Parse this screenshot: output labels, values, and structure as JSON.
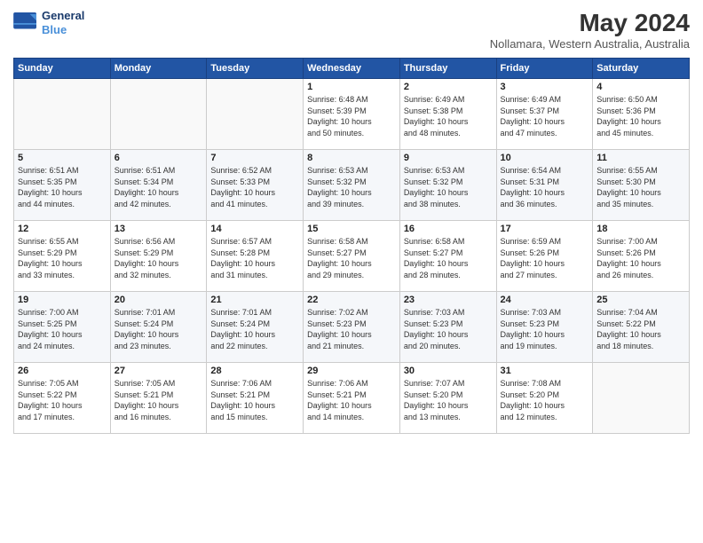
{
  "logo": {
    "line1": "General",
    "line2": "Blue"
  },
  "title": "May 2024",
  "subtitle": "Nollamara, Western Australia, Australia",
  "headers": [
    "Sunday",
    "Monday",
    "Tuesday",
    "Wednesday",
    "Thursday",
    "Friday",
    "Saturday"
  ],
  "rows": [
    [
      {
        "day": "",
        "info": ""
      },
      {
        "day": "",
        "info": ""
      },
      {
        "day": "",
        "info": ""
      },
      {
        "day": "1",
        "info": "Sunrise: 6:48 AM\nSunset: 5:39 PM\nDaylight: 10 hours\nand 50 minutes."
      },
      {
        "day": "2",
        "info": "Sunrise: 6:49 AM\nSunset: 5:38 PM\nDaylight: 10 hours\nand 48 minutes."
      },
      {
        "day": "3",
        "info": "Sunrise: 6:49 AM\nSunset: 5:37 PM\nDaylight: 10 hours\nand 47 minutes."
      },
      {
        "day": "4",
        "info": "Sunrise: 6:50 AM\nSunset: 5:36 PM\nDaylight: 10 hours\nand 45 minutes."
      }
    ],
    [
      {
        "day": "5",
        "info": "Sunrise: 6:51 AM\nSunset: 5:35 PM\nDaylight: 10 hours\nand 44 minutes."
      },
      {
        "day": "6",
        "info": "Sunrise: 6:51 AM\nSunset: 5:34 PM\nDaylight: 10 hours\nand 42 minutes."
      },
      {
        "day": "7",
        "info": "Sunrise: 6:52 AM\nSunset: 5:33 PM\nDaylight: 10 hours\nand 41 minutes."
      },
      {
        "day": "8",
        "info": "Sunrise: 6:53 AM\nSunset: 5:32 PM\nDaylight: 10 hours\nand 39 minutes."
      },
      {
        "day": "9",
        "info": "Sunrise: 6:53 AM\nSunset: 5:32 PM\nDaylight: 10 hours\nand 38 minutes."
      },
      {
        "day": "10",
        "info": "Sunrise: 6:54 AM\nSunset: 5:31 PM\nDaylight: 10 hours\nand 36 minutes."
      },
      {
        "day": "11",
        "info": "Sunrise: 6:55 AM\nSunset: 5:30 PM\nDaylight: 10 hours\nand 35 minutes."
      }
    ],
    [
      {
        "day": "12",
        "info": "Sunrise: 6:55 AM\nSunset: 5:29 PM\nDaylight: 10 hours\nand 33 minutes."
      },
      {
        "day": "13",
        "info": "Sunrise: 6:56 AM\nSunset: 5:29 PM\nDaylight: 10 hours\nand 32 minutes."
      },
      {
        "day": "14",
        "info": "Sunrise: 6:57 AM\nSunset: 5:28 PM\nDaylight: 10 hours\nand 31 minutes."
      },
      {
        "day": "15",
        "info": "Sunrise: 6:58 AM\nSunset: 5:27 PM\nDaylight: 10 hours\nand 29 minutes."
      },
      {
        "day": "16",
        "info": "Sunrise: 6:58 AM\nSunset: 5:27 PM\nDaylight: 10 hours\nand 28 minutes."
      },
      {
        "day": "17",
        "info": "Sunrise: 6:59 AM\nSunset: 5:26 PM\nDaylight: 10 hours\nand 27 minutes."
      },
      {
        "day": "18",
        "info": "Sunrise: 7:00 AM\nSunset: 5:26 PM\nDaylight: 10 hours\nand 26 minutes."
      }
    ],
    [
      {
        "day": "19",
        "info": "Sunrise: 7:00 AM\nSunset: 5:25 PM\nDaylight: 10 hours\nand 24 minutes."
      },
      {
        "day": "20",
        "info": "Sunrise: 7:01 AM\nSunset: 5:24 PM\nDaylight: 10 hours\nand 23 minutes."
      },
      {
        "day": "21",
        "info": "Sunrise: 7:01 AM\nSunset: 5:24 PM\nDaylight: 10 hours\nand 22 minutes."
      },
      {
        "day": "22",
        "info": "Sunrise: 7:02 AM\nSunset: 5:23 PM\nDaylight: 10 hours\nand 21 minutes."
      },
      {
        "day": "23",
        "info": "Sunrise: 7:03 AM\nSunset: 5:23 PM\nDaylight: 10 hours\nand 20 minutes."
      },
      {
        "day": "24",
        "info": "Sunrise: 7:03 AM\nSunset: 5:23 PM\nDaylight: 10 hours\nand 19 minutes."
      },
      {
        "day": "25",
        "info": "Sunrise: 7:04 AM\nSunset: 5:22 PM\nDaylight: 10 hours\nand 18 minutes."
      }
    ],
    [
      {
        "day": "26",
        "info": "Sunrise: 7:05 AM\nSunset: 5:22 PM\nDaylight: 10 hours\nand 17 minutes."
      },
      {
        "day": "27",
        "info": "Sunrise: 7:05 AM\nSunset: 5:21 PM\nDaylight: 10 hours\nand 16 minutes."
      },
      {
        "day": "28",
        "info": "Sunrise: 7:06 AM\nSunset: 5:21 PM\nDaylight: 10 hours\nand 15 minutes."
      },
      {
        "day": "29",
        "info": "Sunrise: 7:06 AM\nSunset: 5:21 PM\nDaylight: 10 hours\nand 14 minutes."
      },
      {
        "day": "30",
        "info": "Sunrise: 7:07 AM\nSunset: 5:20 PM\nDaylight: 10 hours\nand 13 minutes."
      },
      {
        "day": "31",
        "info": "Sunrise: 7:08 AM\nSunset: 5:20 PM\nDaylight: 10 hours\nand 12 minutes."
      },
      {
        "day": "",
        "info": ""
      }
    ]
  ]
}
